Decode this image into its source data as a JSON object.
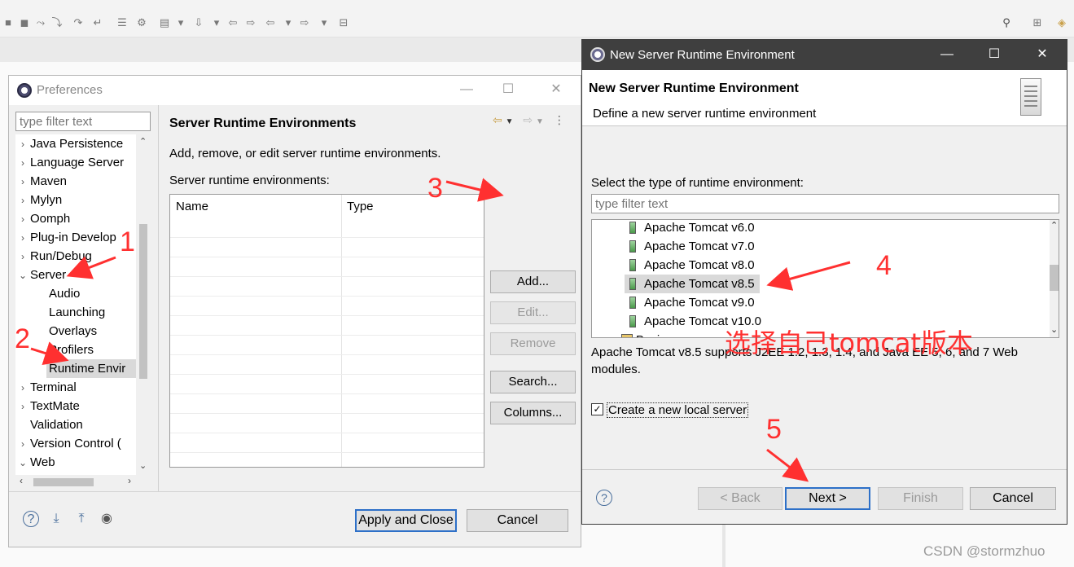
{
  "ide": {
    "watermark": "CSDN @stormzhuo"
  },
  "preferences": {
    "title": "Preferences",
    "filter_placeholder": "type filter text",
    "tree": [
      {
        "label": "Java Persistence",
        "expanded": false,
        "level": 0
      },
      {
        "label": "Language Server",
        "expanded": false,
        "level": 0
      },
      {
        "label": "Maven",
        "expanded": false,
        "level": 0
      },
      {
        "label": "Mylyn",
        "expanded": false,
        "level": 0
      },
      {
        "label": "Oomph",
        "expanded": false,
        "level": 0
      },
      {
        "label": "Plug-in Develop",
        "expanded": false,
        "level": 0
      },
      {
        "label": "Run/Debug",
        "expanded": false,
        "level": 0
      },
      {
        "label": "Server",
        "expanded": true,
        "level": 0
      },
      {
        "label": "Audio",
        "level": 1
      },
      {
        "label": "Launching",
        "level": 1
      },
      {
        "label": "Overlays",
        "level": 1
      },
      {
        "label": "Profilers",
        "level": 1
      },
      {
        "label": "Runtime Envir",
        "level": 1,
        "selected": true
      },
      {
        "label": "Terminal",
        "expanded": false,
        "level": 0
      },
      {
        "label": "TextMate",
        "expanded": false,
        "level": 0
      },
      {
        "label": "Validation",
        "level": 0
      },
      {
        "label": "Version Control (",
        "expanded": false,
        "level": 0
      },
      {
        "label": "Web",
        "expanded": true,
        "level": 0
      }
    ],
    "page_title": "Server Runtime Environments",
    "description": "Add, remove, or edit server runtime environments.",
    "list_label": "Server runtime environments:",
    "columns": [
      "Name",
      "Type"
    ],
    "buttons": {
      "add": "Add...",
      "edit": "Edit...",
      "remove": "Remove",
      "search": "Search...",
      "columns": "Columns..."
    },
    "apply_close": "Apply and Close",
    "cancel": "Cancel"
  },
  "wizard": {
    "window_title": "New Server Runtime Environment",
    "header_title": "New Server Runtime Environment",
    "header_desc": "Define a new server runtime environment",
    "select_label": "Select the type of runtime environment:",
    "filter_placeholder": "type filter text",
    "runtimes": [
      "Apache Tomcat v6.0",
      "Apache Tomcat v7.0",
      "Apache Tomcat v8.0",
      "Apache Tomcat v8.5",
      "Apache Tomcat v9.0",
      "Apache Tomcat v10.0",
      "Basic"
    ],
    "selected_runtime": "Apache Tomcat v8.5",
    "info": "Apache Tomcat v8.5 supports J2EE 1.2, 1.3, 1.4, and Java EE 5, 6, and 7 Web modules.",
    "create_server_label": "Create a new local server",
    "create_server_checked": true,
    "buttons": {
      "back": "< Back",
      "next": "Next >",
      "finish": "Finish",
      "cancel": "Cancel"
    }
  },
  "annotations": {
    "steps": [
      "1",
      "2",
      "3",
      "4",
      "5"
    ],
    "note": "选择自己tomcat版本",
    "color": "#ff3030"
  }
}
